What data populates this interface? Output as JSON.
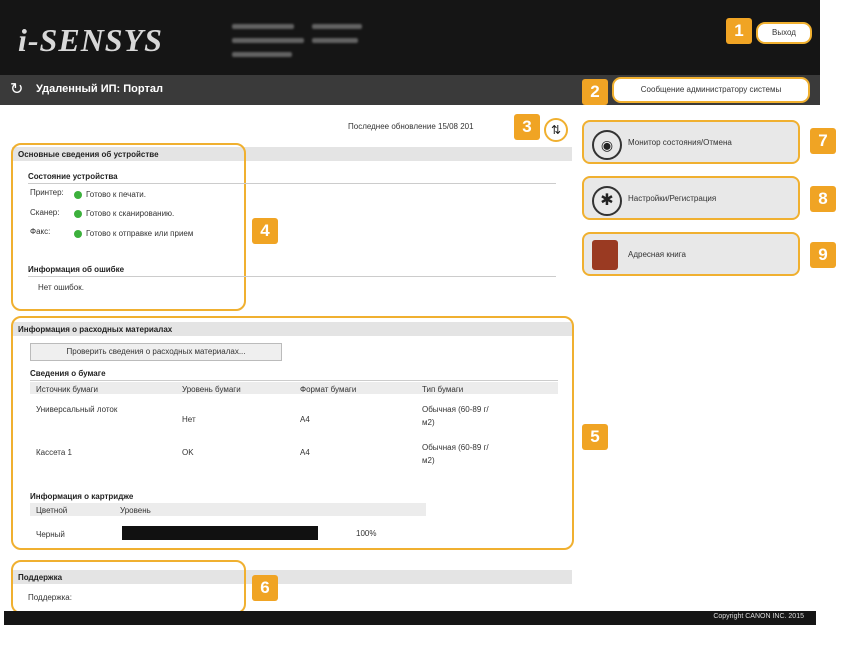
{
  "brand": {
    "logo": "i-SENSYS"
  },
  "header": {
    "title": "Удаленный ИП: Портал",
    "logout_label": "Выход",
    "admin_message_label": "Сообщение администратору системы"
  },
  "last_update": "Последнее обновление 15/08 201",
  "badges": [
    "1",
    "2",
    "3",
    "4",
    "5",
    "6",
    "7",
    "8",
    "9"
  ],
  "device_info": {
    "title": "Основные сведения об устройстве",
    "status_heading": "Состояние устройства",
    "rows": [
      {
        "label": "Принтер:",
        "value": "Готово к печати."
      },
      {
        "label": "Сканер:",
        "value": "Готово к сканированию."
      },
      {
        "label": "Факс:",
        "value": "Готово к отправке или прием"
      }
    ],
    "error_heading": "Информация об ошибке",
    "error_text": "Нет ошибок."
  },
  "consumables": {
    "title": "Информация о расходных материалах",
    "check_button": "Проверить сведения о расходных материалах...",
    "paper_heading": "Сведения о бумаге",
    "paper_columns": [
      "Источник бумаги",
      "Уровень бумаги",
      "Формат бумаги",
      "Тип бумаги"
    ],
    "paper_rows": [
      {
        "source": "Универсальный лоток",
        "level": "Нет",
        "format": "A4",
        "type": "Обычная (60-89 г/м2)"
      },
      {
        "source": "Кассета 1",
        "level": "OK",
        "format": "A4",
        "type": "Обычная (60-89 г/м2)"
      }
    ],
    "cartridge_heading": "Информация о картридже",
    "cartridge_columns": [
      "Цветной",
      "Уровень"
    ],
    "cartridge_rows": [
      {
        "color": "Черный",
        "level": 100,
        "level_text": "100%"
      }
    ]
  },
  "support": {
    "title": "Поддержка",
    "text": "Поддержка:"
  },
  "nav": [
    {
      "label": "Монитор состояния/Отмена",
      "icon": "eye-icon"
    },
    {
      "label": "Настройки/Регистрация",
      "icon": "settings-icon"
    },
    {
      "label": "Адресная книга",
      "icon": "address-book-icon"
    }
  ],
  "footer": {
    "copyright": "Copyright CANON INC. 2015"
  },
  "colors": {
    "accent": "#f0a424",
    "header": "#151515",
    "status_ok": "#3cb03c"
  }
}
